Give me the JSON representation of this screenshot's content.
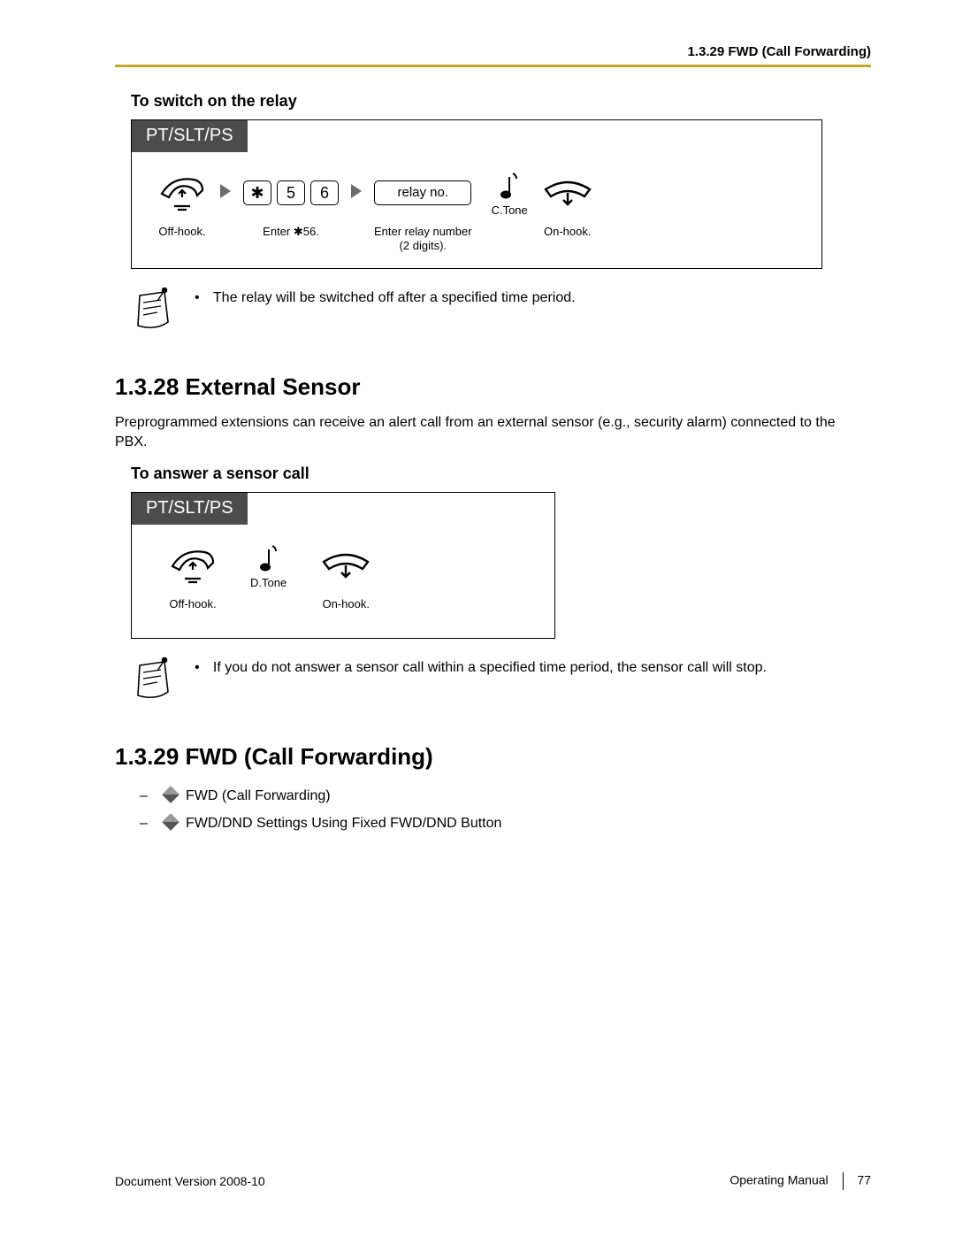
{
  "header": {
    "breadcrumb": "1.3.29 FWD (Call Forwarding)"
  },
  "relay": {
    "title": "To switch on the relay",
    "tab": "PT/SLT/PS",
    "steps": {
      "offhook": "Off-hook.",
      "enter56_key_star": "✱",
      "enter56_key_5": "5",
      "enter56_key_6": "6",
      "enter56_label": "Enter ✱56.",
      "relayno_key": "relay no.",
      "relayno_label": "Enter relay number\n(2 digits).",
      "ctone": "C.Tone",
      "onhook": "On-hook."
    },
    "note": "The relay will be switched off after a specified time period."
  },
  "sensor": {
    "heading": "1.3.28  External Sensor",
    "intro": "Preprogrammed extensions can receive an alert call from an external sensor (e.g., security alarm) connected to the PBX.",
    "sub": "To answer a sensor call",
    "tab": "PT/SLT/PS",
    "steps": {
      "offhook": "Off-hook.",
      "dtone": "D.Tone",
      "onhook": "On-hook."
    },
    "note": "If you do not answer a sensor call within a specified time period, the sensor call will stop."
  },
  "fwd": {
    "heading": "1.3.29  FWD (Call Forwarding)",
    "items": [
      "FWD (Call Forwarding)",
      "FWD/DND Settings Using Fixed FWD/DND Button"
    ]
  },
  "footer": {
    "left": "Document Version  2008-10",
    "manual": "Operating Manual",
    "page": "77"
  }
}
